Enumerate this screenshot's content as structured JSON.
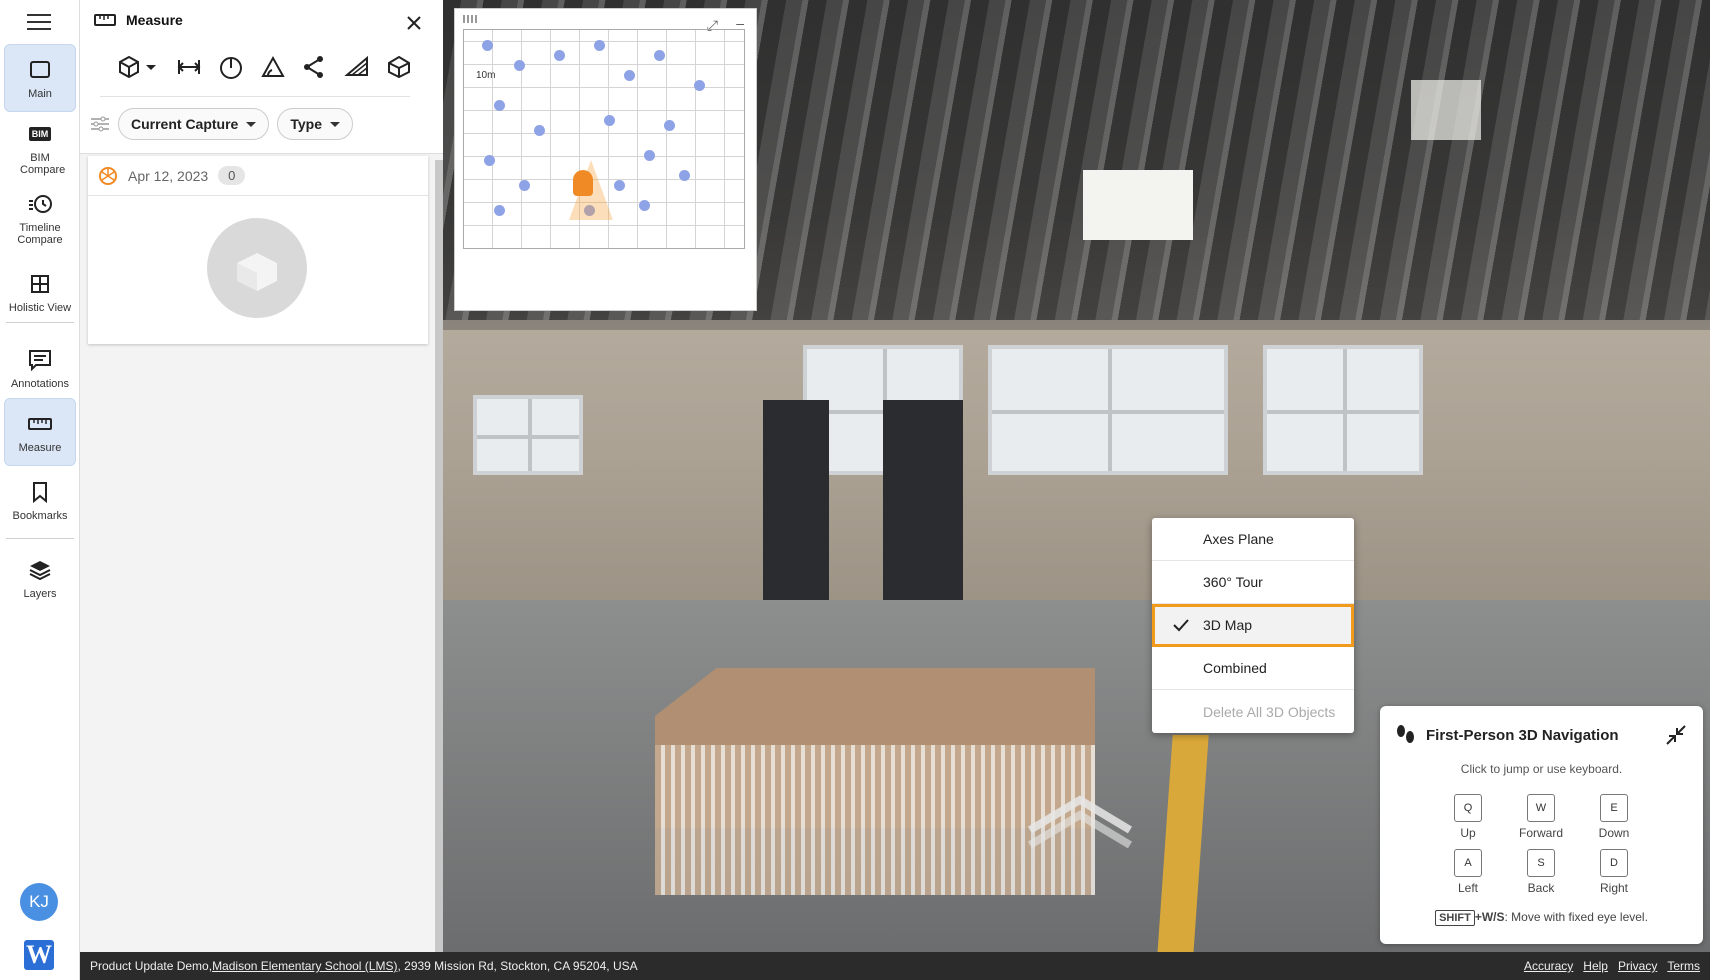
{
  "rail": {
    "items": [
      {
        "label": "Main",
        "icon": "square-icon"
      },
      {
        "label": "BIM Compare",
        "icon": "bim-icon"
      },
      {
        "label": "Timeline Compare",
        "icon": "timeline-icon"
      },
      {
        "label": "Holistic View",
        "icon": "grid-icon"
      },
      {
        "label": "Annotations",
        "icon": "comment-icon"
      },
      {
        "label": "Measure",
        "icon": "ruler-icon"
      },
      {
        "label": "Bookmarks",
        "icon": "bookmark-icon"
      },
      {
        "label": "Layers",
        "icon": "layers-icon"
      }
    ],
    "bim_badge": "BIM",
    "avatar_initials": "KJ",
    "logo_letter": "W"
  },
  "panel": {
    "title": "Measure",
    "filters": {
      "capture": "Current Capture",
      "type": "Type"
    },
    "capture_date": "Apr 12, 2023",
    "capture_count": "0"
  },
  "minimap": {
    "scale": "10m"
  },
  "dropdown": {
    "items": [
      {
        "label": "Axes Plane"
      },
      {
        "label": "360° Tour"
      },
      {
        "label": "3D Map",
        "selected": true
      },
      {
        "label": "Combined"
      },
      {
        "label": "Delete All 3D Objects",
        "disabled": true
      }
    ]
  },
  "navhelp": {
    "title": "First-Person 3D Navigation",
    "subtitle": "Click to jump or use keyboard.",
    "keys": [
      {
        "key": "Q",
        "label": "Up"
      },
      {
        "key": "W",
        "label": "Forward"
      },
      {
        "key": "E",
        "label": "Down"
      },
      {
        "key": "A",
        "label": "Left"
      },
      {
        "key": "S",
        "label": "Back"
      },
      {
        "key": "D",
        "label": "Right"
      }
    ],
    "shift": "SHIFT",
    "shift_combo": "+W/S",
    "shift_text": ": Move with fixed eye level."
  },
  "footer": {
    "prefix": "Product Update Demo, ",
    "project_link": "Madison Elementary School (LMS)",
    "address": ", 2939 Mission Rd, Stockton, CA 95204, USA",
    "links": [
      "Accuracy",
      "Help",
      "Privacy",
      "Terms"
    ]
  },
  "colors": {
    "accent": "#f29a1a",
    "rail_active": "#dbe7f7",
    "avatar": "#4a90e2"
  }
}
